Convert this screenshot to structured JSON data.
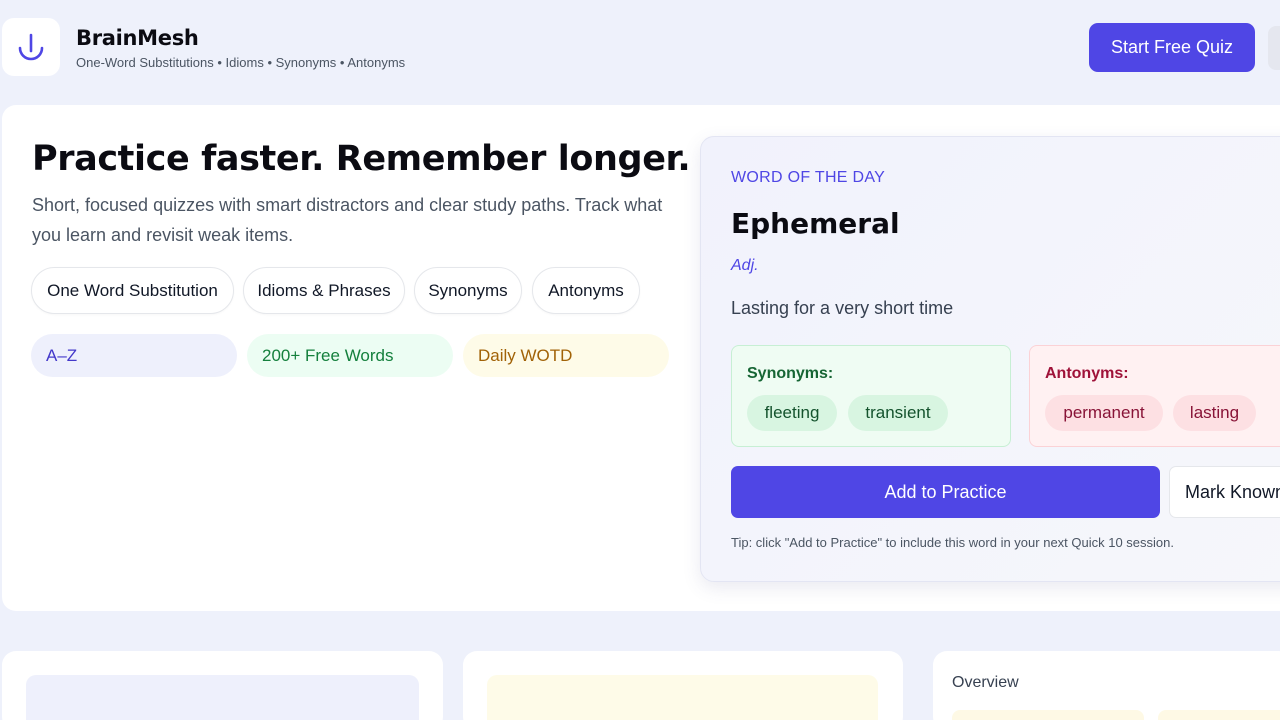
{
  "header": {
    "brand_name": "BrainMesh",
    "tagline": "One-Word Substitutions • Idioms • Synonyms • Antonyms",
    "start_button": "Start Free Quiz",
    "logo_icon": "anchor-hook-icon",
    "accent_color": "#4f46e5"
  },
  "hero": {
    "title": "Practice faster. Remember longer.",
    "description": "Short, focused quizzes with smart distractors and clear study paths. Track what you learn and revisit weak items.",
    "categories": [
      "One Word Substitution",
      "Idioms & Phrases",
      "Synonyms",
      "Antonyms"
    ],
    "badges": [
      {
        "label": "A–Z",
        "color": "#4338ca",
        "bg": "#eef0fc"
      },
      {
        "label": "200+ Free Words",
        "color": "#15803d",
        "bg": "#ecfdf3"
      },
      {
        "label": "Daily WOTD",
        "color": "#a16207",
        "bg": "#fefbe8"
      }
    ]
  },
  "wotd": {
    "label": "WORD OF THE DAY",
    "word": "Ephemeral",
    "part_of_speech": "Adj.",
    "definition": "Lasting for a very short time",
    "synonyms_title": "Synonyms:",
    "synonyms": [
      "fleeting",
      "transient"
    ],
    "antonyms_title": "Antonyms:",
    "antonyms": [
      "permanent",
      "lasting"
    ],
    "add_button": "Add to Practice",
    "known_button": "Mark Known",
    "tip": "Tip: click \"Add to Practice\" to include this word in your next Quick 10 session."
  },
  "bottom": {
    "overview_title": "Overview"
  }
}
